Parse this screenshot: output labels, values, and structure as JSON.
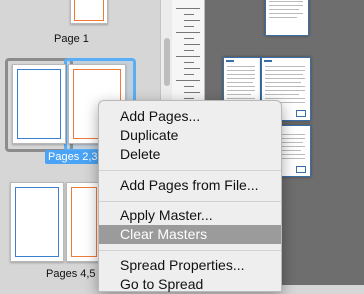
{
  "pages_panel": {
    "thumbnails": [
      {
        "label": "Page 1",
        "selected": false
      },
      {
        "label": "Pages 2,3",
        "selected": true
      },
      {
        "label": "Pages 4,5",
        "selected": false
      }
    ]
  },
  "context_menu": {
    "items": [
      {
        "label": "Add Pages...",
        "highlighted": false
      },
      {
        "label": "Duplicate",
        "highlighted": false
      },
      {
        "label": "Delete",
        "highlighted": false
      },
      {
        "label": "Add Pages from File...",
        "highlighted": false
      },
      {
        "label": "Apply Master...",
        "highlighted": false
      },
      {
        "label": "Clear Masters",
        "highlighted": true
      },
      {
        "label": "Spread Properties...",
        "highlighted": false
      },
      {
        "label": "Go to Spread",
        "highlighted": false
      }
    ]
  },
  "colors": {
    "highlight": "#9b9b9b",
    "selection_blue": "#4aa3f4",
    "master_frame_orange": "#f07a3a",
    "master_frame_blue": "#3a7fd0"
  }
}
